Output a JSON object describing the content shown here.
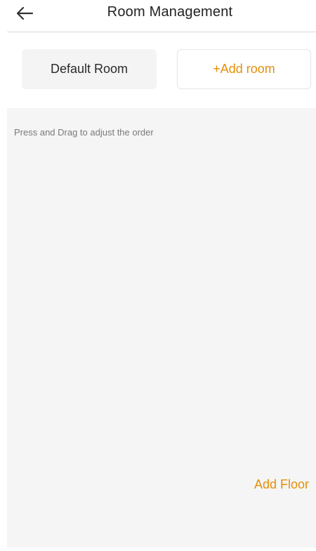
{
  "header": {
    "title": "Room Management",
    "back_icon": "arrow-left-icon"
  },
  "rooms": {
    "default_label": "Default Room",
    "add_label": "+Add room"
  },
  "panel": {
    "hint": "Press and Drag to adjust the order",
    "add_floor_label": "Add Floor"
  },
  "colors": {
    "accent": "#e58f0a",
    "panel_bg": "#f5f5f5",
    "text_primary": "#222222",
    "text_hint": "#7a7a7a"
  }
}
